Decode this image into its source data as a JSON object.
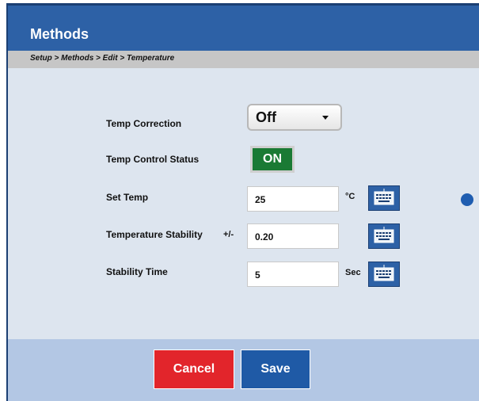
{
  "header": {
    "title": "Methods"
  },
  "breadcrumb": "Setup > Methods > Edit > Temperature",
  "form": {
    "temp_correction": {
      "label": "Temp Correction",
      "value": "Off"
    },
    "temp_control_status": {
      "label": "Temp Control Status",
      "value": "ON"
    },
    "set_temp": {
      "label": "Set Temp",
      "value": "25",
      "unit": "°C"
    },
    "temperature_stability": {
      "label": "Temperature Stability",
      "prefix": "+/-",
      "value": "0.20"
    },
    "stability_time": {
      "label": "Stability Time",
      "value": "5",
      "unit": "Sec"
    }
  },
  "footer": {
    "cancel_label": "Cancel",
    "save_label": "Save"
  },
  "colors": {
    "title_bar": "#2d61a6",
    "on_toggle": "#1a7a34",
    "cancel": "#e2252b",
    "save": "#1f5aa6"
  }
}
